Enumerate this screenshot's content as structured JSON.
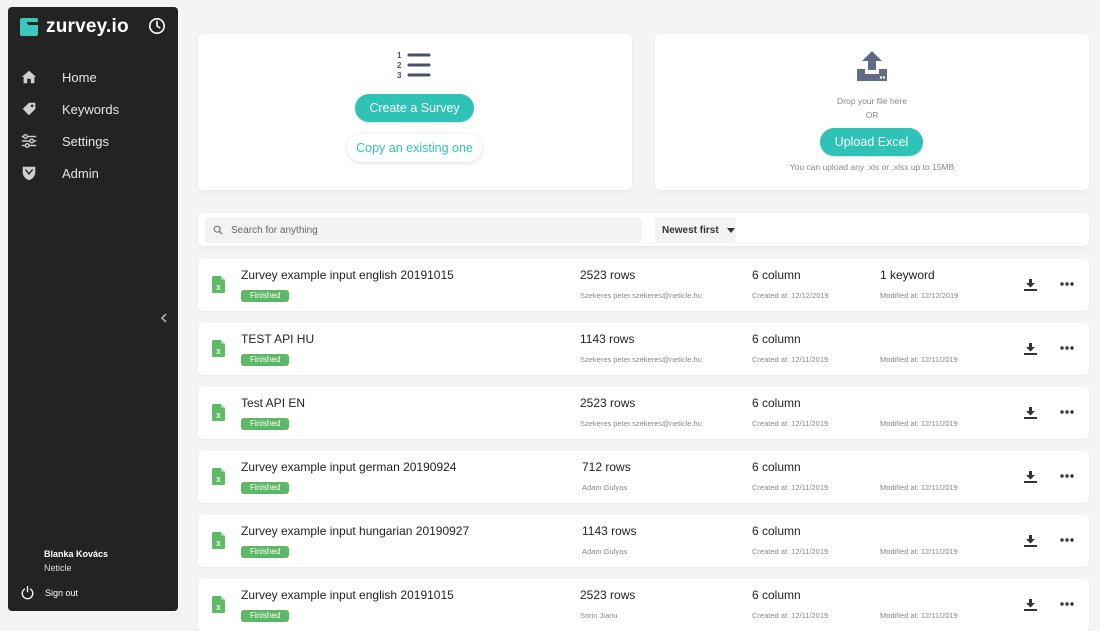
{
  "app": {
    "name": "zurvey.io"
  },
  "sidebar": {
    "items": [
      {
        "label": "Home",
        "icon": "home-icon"
      },
      {
        "label": "Keywords",
        "icon": "tag-icon"
      },
      {
        "label": "Settings",
        "icon": "sliders-icon"
      },
      {
        "label": "Admin",
        "icon": "shield-icon"
      }
    ],
    "user": {
      "name": "Blanka Kovács",
      "org": "Neticle"
    },
    "signout": "Sign out"
  },
  "create_card": {
    "create_label": "Create a Survey",
    "copy_label": "Copy an existing one"
  },
  "upload_card": {
    "drop_text": "Drop your file here",
    "or_text": "OR",
    "upload_label": "Upload Excel",
    "hint": "You can upload any .xls or .xlsx up to 15MB"
  },
  "toolbar": {
    "search_placeholder": "Search for anything",
    "sort_label": "Newest first"
  },
  "colors": {
    "accent": "#2fc3b7",
    "status_finished": "#5fb866",
    "sidebar_bg": "#232323",
    "excel_green": "#5fb866"
  },
  "surveys": [
    {
      "title": "Zurvey example input english 20191015",
      "status": "Finished",
      "rows": "2523 rows",
      "owner": "Szekeres peter.szekeres@neticle.hu",
      "columns": "6 column",
      "created": "Created at: 12/12/2019",
      "keywords": "1 keyword",
      "modified": "Modified at: 12/12/2019"
    },
    {
      "title": "TEST API HU",
      "status": "Finished",
      "rows": "1143 rows",
      "owner": "Szekeres peter.szekeres@neticle.hu",
      "columns": "6 column",
      "created": "Created at: 12/11/2019",
      "keywords": "",
      "modified": "Modified at: 12/11/2019"
    },
    {
      "title": "Test API EN",
      "status": "Finished",
      "rows": "2523 rows",
      "owner": "Szekeres peter.szekeres@neticle.hu",
      "columns": "6 column",
      "created": "Created at: 12/11/2019",
      "keywords": "",
      "modified": "Modified at: 12/11/2019"
    },
    {
      "title": "Zurvey example input german 20190924",
      "status": "Finished",
      "rows": "712 rows",
      "owner": "Adam Gulyas",
      "columns": "6 column",
      "created": "Created at: 12/11/2019",
      "keywords": "",
      "modified": "Modified at: 12/11/2019"
    },
    {
      "title": "Zurvey example input hungarian 20190927",
      "status": "Finished",
      "rows": "1143 rows",
      "owner": "Adam Gulyas",
      "columns": "6 column",
      "created": "Created at: 12/11/2019",
      "keywords": "",
      "modified": "Modified at: 12/11/2019"
    },
    {
      "title": "Zurvey example input english 20191015",
      "status": "Finished",
      "rows": "2523 rows",
      "owner": "Sorin Jianu",
      "columns": "6 column",
      "created": "Created at: 12/11/2019",
      "keywords": "",
      "modified": "Modified at: 12/11/2019"
    }
  ]
}
